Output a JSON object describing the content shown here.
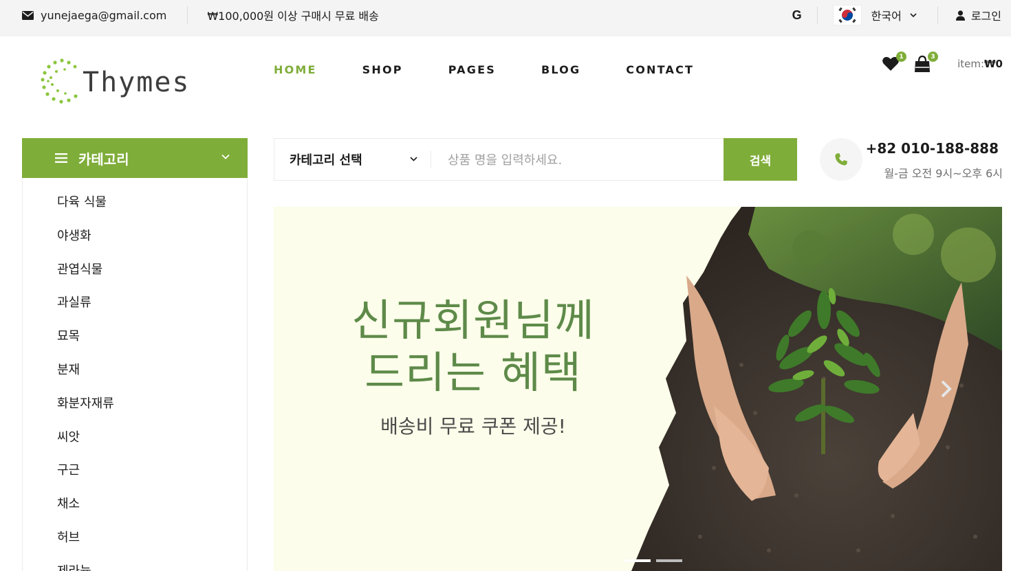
{
  "topbar": {
    "email": "yunejaega@gmail.com",
    "shipping": "₩100,000원 이상 구매시 무료 배송",
    "language": "한국어",
    "login": "로그인"
  },
  "logo": {
    "text": "Thymes"
  },
  "nav": {
    "items": [
      "HOME",
      "SHOP",
      "PAGES",
      "BLOG",
      "CONTACT"
    ],
    "active": "HOME"
  },
  "header_icons": {
    "wishlist_count": "1",
    "cart_count": "3",
    "item_label": "item:",
    "item_value": "₩0"
  },
  "category_menu": {
    "title": "카테고리",
    "items": [
      "다육 식물",
      "야생화",
      "관엽식물",
      "과실류",
      "묘목",
      "분재",
      "화분자재류",
      "씨앗",
      "구근",
      "채소",
      "허브",
      "제라늄"
    ]
  },
  "search": {
    "category": "카테고리 선택",
    "placeholder": "상품 명을 입력하세요.",
    "button": "검색"
  },
  "contact": {
    "phone": "+82 010-188-888",
    "hours": "월-금 오전 9시~오후 6시"
  },
  "hero": {
    "title_line1": "신규회원님께",
    "title_line2": "드리는 혜택",
    "subtitle": "배송비 무료 쿠폰 제공!",
    "slides": 2,
    "active_slide": 1
  },
  "colors": {
    "accent": "#7fad39",
    "hero_bg": "#fcfdea",
    "hero_title": "#5e8a49"
  },
  "icons": [
    "envelope-icon",
    "google-icon",
    "korea-flag-icon",
    "chevron-down-icon",
    "user-icon",
    "heart-icon",
    "bag-icon",
    "menu-icon",
    "phone-icon",
    "chevron-right-icon"
  ]
}
